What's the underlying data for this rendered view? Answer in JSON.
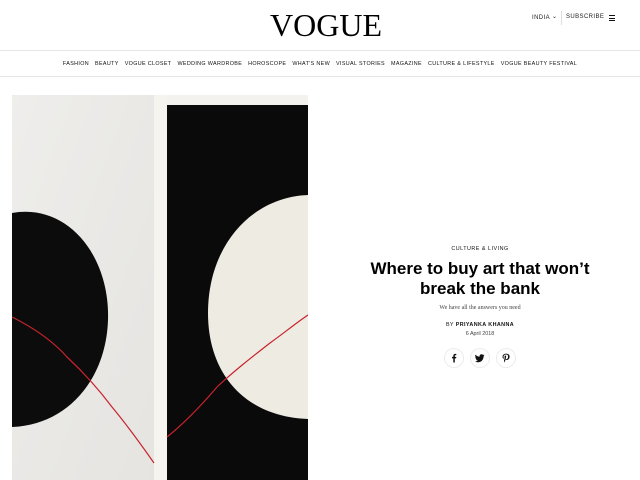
{
  "header": {
    "logo": "VOGUE",
    "region_label": "INDIA",
    "subscribe_label": "SUBSCRIBE"
  },
  "nav": {
    "items": [
      "FASHION",
      "BEAUTY",
      "VOGUE CLOSET",
      "WEDDING WARDROBE",
      "HOROSCOPE",
      "WHAT'S NEW",
      "VISUAL STORIES",
      "MAGAZINE",
      "CULTURE & LIFESTYLE",
      "VOGUE BEAUTY FESTIVAL"
    ]
  },
  "article": {
    "category": "CULTURE & LIVING",
    "title": "Where to buy art that won’t break the bank",
    "dek": "We have all the answers you need",
    "byline_prefix": "BY ",
    "author": "PRIYANKA KHANNA",
    "date": "6 April 2018"
  },
  "share": {
    "icons": [
      "facebook-icon",
      "twitter-icon",
      "pinterest-icon"
    ]
  },
  "colors": {
    "text": "#111111",
    "accent_line": "#c8232c",
    "art_dark": "#0b0b0b",
    "art_light": "#f1efeb"
  }
}
